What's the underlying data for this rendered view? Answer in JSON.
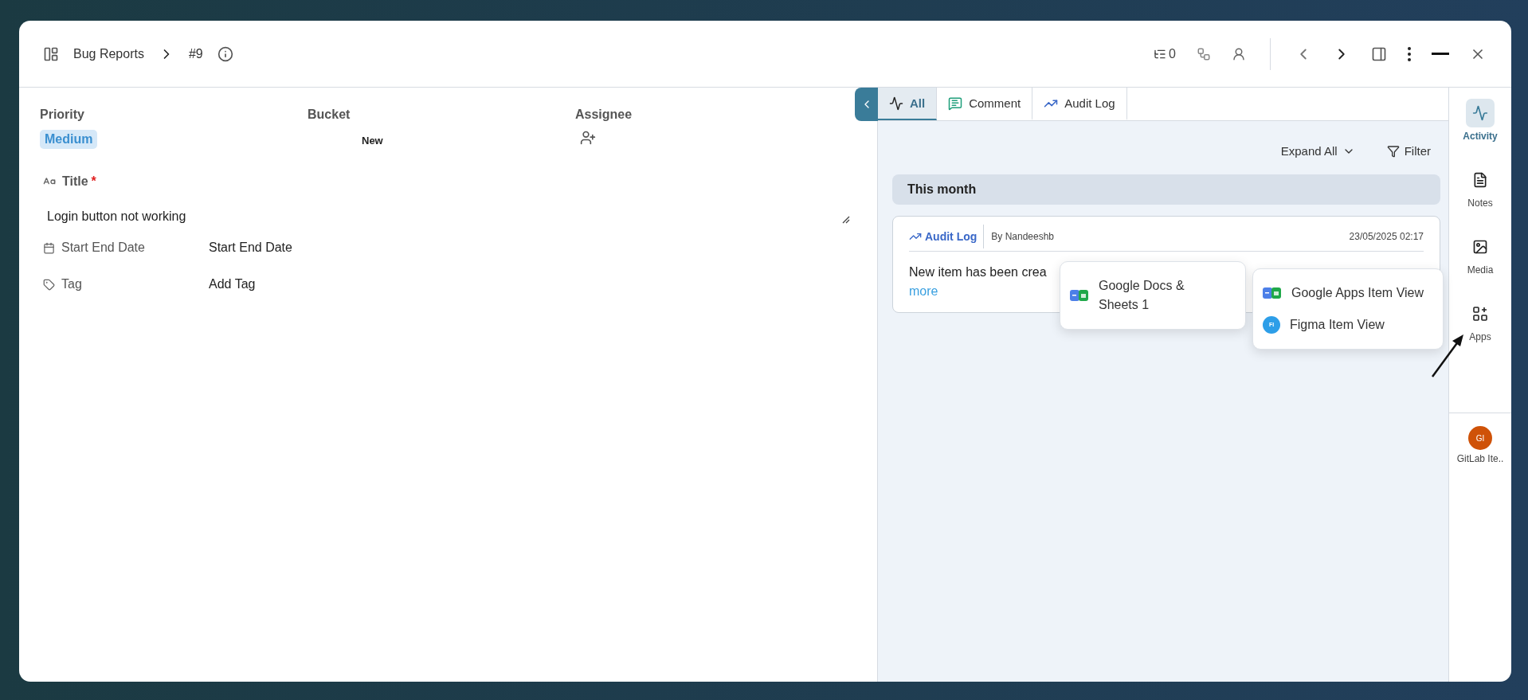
{
  "header": {
    "breadcrumb": [
      "Bug Reports",
      "#9"
    ],
    "subitem_count": "0"
  },
  "fields": [
    {
      "label": "Priority",
      "value": "Medium",
      "kind": "chip"
    },
    {
      "label": "Bucket",
      "value": "New",
      "kind": "text"
    },
    {
      "label": "Assignee",
      "kind": "assignee"
    }
  ],
  "title_field": {
    "label": "Title",
    "required": "*",
    "value": "Login button not working"
  },
  "properties": [
    {
      "label": "Start End Date",
      "value": "Start End Date",
      "kind": "date"
    },
    {
      "label": "Tag",
      "value": "Add Tag",
      "kind": "tag"
    }
  ],
  "activity_tabs": [
    {
      "label": "All",
      "selected": true,
      "kind": "all"
    },
    {
      "label": "Comment",
      "selected": false,
      "kind": "comment"
    },
    {
      "label": "Audit Log",
      "selected": false,
      "kind": "audit"
    }
  ],
  "toolbar": {
    "expand": "Expand All",
    "filter": "Filter"
  },
  "group": "This month",
  "entry": {
    "type": "Audit Log",
    "author": "By Nandeeshb",
    "time": "23/05/2025 02:17",
    "text": "New item has been crea",
    "link": "more"
  },
  "popups": [
    {
      "items": [
        {
          "label": "Google Docs & Sheets 1",
          "kind": "google"
        }
      ]
    },
    {
      "items": [
        {
          "label": "Google Apps Item View",
          "kind": "google"
        },
        {
          "label": "Figma Item View",
          "kind": "figma",
          "badge": "FI"
        }
      ]
    }
  ],
  "sidebar": [
    {
      "label": "Activity",
      "selected": true,
      "kind": "activity"
    },
    {
      "label": "Notes",
      "selected": false,
      "kind": "notes"
    },
    {
      "label": "Media",
      "selected": false,
      "kind": "media"
    },
    {
      "label": "Apps",
      "selected": false,
      "kind": "apps"
    }
  ],
  "app": {
    "initials": "GI",
    "label": "GitLab Ite.."
  }
}
